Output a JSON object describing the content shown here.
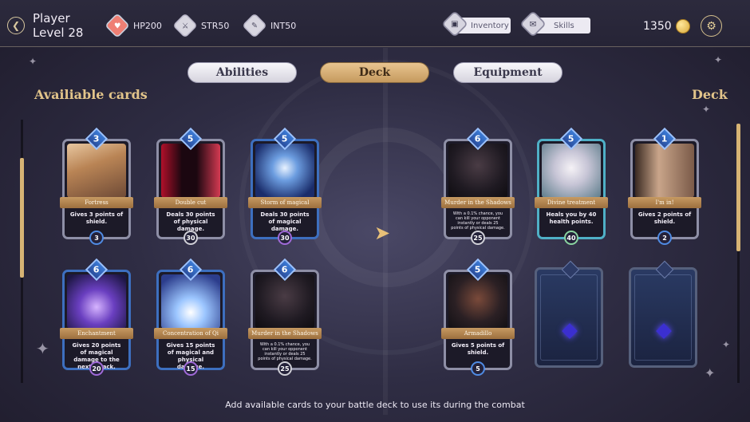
{
  "player": {
    "name": "Player",
    "level": "Level 28"
  },
  "stats": [
    {
      "label": "HP200",
      "icon": "heart-icon",
      "glyph": "♥"
    },
    {
      "label": "STR50",
      "icon": "sword-icon",
      "glyph": "⚔"
    },
    {
      "label": "INT50",
      "icon": "book-icon",
      "glyph": "✎"
    }
  ],
  "nav": {
    "inventory": "Inventory",
    "skills": "Skills"
  },
  "coins": "1350",
  "tabs": {
    "abilities": "Abilities",
    "deck": "Deck",
    "equipment": "Equipment"
  },
  "sections": {
    "available": "Availiable cards",
    "deck": "Deck"
  },
  "available_cards": [
    {
      "cost": "3",
      "name": "Fortress",
      "desc": "Gives 3 points of shield.",
      "power": "3",
      "art": "castle"
    },
    {
      "cost": "5",
      "name": "Double cut",
      "desc": "Deals 30 points of physical damage.",
      "power": "30",
      "art": "fire"
    },
    {
      "cost": "5",
      "name": "Storm of magical",
      "desc": "Deals 30 points of magical damage.",
      "power": "30",
      "art": "storm"
    },
    {
      "cost": "6",
      "name": "Enchantment",
      "desc": "Gives 20 points of magical damage to the next attack.",
      "power": "20",
      "art": "magic"
    },
    {
      "cost": "6",
      "name": "Concentration of Qi",
      "desc": "Gives 15 points of magical and physical damage.",
      "power": "15",
      "art": "qi"
    },
    {
      "cost": "6",
      "name": "Murder in the Shadows",
      "desc": "With a 0.1% chance, you can kill your opponent instantly or deals 25 points of physical damage.",
      "power": "25",
      "art": "shadow"
    }
  ],
  "deck_cards": [
    {
      "cost": "6",
      "name": "Murder in the Shadows",
      "desc": "With a 0.1% chance, you can kill your opponent instantly or deals 25 points of physical damage.",
      "power": "25",
      "art": "shadow"
    },
    {
      "cost": "5",
      "name": "Divine treatment",
      "desc": "Heals you by 40 health points.",
      "power": "40",
      "art": "divine"
    },
    {
      "cost": "1",
      "name": "I'm in!",
      "desc": "Gives 2 points of shield.",
      "power": "2",
      "art": "door"
    },
    {
      "cost": "5",
      "name": "Armadillo",
      "desc": "Gives 5 points of shield.",
      "power": "5",
      "art": "armor"
    }
  ],
  "footer": "Add available cards to your battle deck to use its during the combat"
}
